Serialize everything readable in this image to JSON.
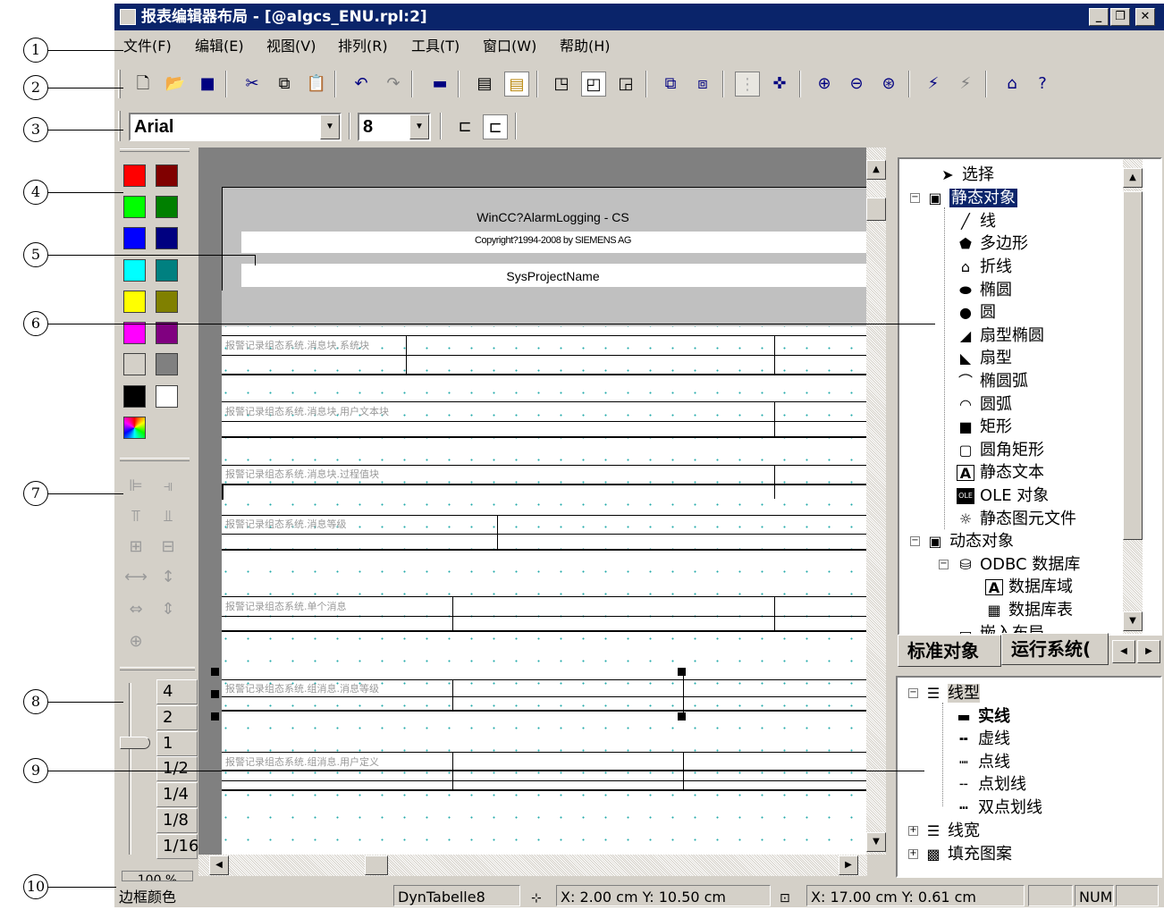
{
  "window": {
    "title": "报表编辑器布局 - [@algcs_ENU.rpl:2]",
    "buttons": [
      "_",
      "❐",
      "✕"
    ]
  },
  "callouts": [
    "1",
    "2",
    "3",
    "4",
    "5",
    "6",
    "7",
    "8",
    "9",
    "10"
  ],
  "menu": [
    "文件(F)",
    "编辑(E)",
    "视图(V)",
    "排列(R)",
    "工具(T)",
    "窗口(W)",
    "帮助(H)"
  ],
  "font_toolbar": {
    "font": "Arial",
    "size": "8"
  },
  "zoom": {
    "levels": [
      "4",
      "2",
      "1",
      "1/2",
      "1/4",
      "1/8",
      "1/16"
    ],
    "current": "1",
    "partial_label": "100 %"
  },
  "colors": {
    "palette": [
      "#ff0000",
      "#800000",
      "#00ff00",
      "#008000",
      "#0000ff",
      "#000080",
      "#00ffff",
      "#008080",
      "#ffff00",
      "#808000",
      "#ff00ff",
      "#800080",
      "#d4d0c8",
      "#808080",
      "#000000",
      "#ffffff"
    ],
    "titlebar": "#0a246a",
    "selection": "#0a246a"
  },
  "report": {
    "header_line1": "WinCC?AlarmLogging - CS",
    "header_line2": "Copyright?1994-2008 by SIEMENS AG",
    "project_name": "SysProjectName",
    "rows": [
      "报警记录组态系统.消息块.系统块",
      "报警记录组态系统.消息块.用户文本块",
      "报警记录组态系统.消息块.过程值块",
      "报警记录组态系统.消息等级",
      "报警记录组态系统.单个消息",
      "报警记录组态系统.组消息.消息等级",
      "报警记录组态系统.组消息.用户定义"
    ]
  },
  "objects_tree": {
    "select": "选择",
    "static": "静态对象",
    "static_items": [
      "线",
      "多边形",
      "折线",
      "椭圆",
      "圆",
      "扇型椭圆",
      "扇型",
      "椭圆弧",
      "圆弧",
      "矩形",
      "圆角矩形",
      "静态文本",
      "OLE 对象",
      "静态图元文件"
    ],
    "dynamic": "动态对象",
    "odbc": "ODBC 数据库",
    "odbc_items": [
      "数据库域",
      "数据库表"
    ],
    "partial": "嵌入布局"
  },
  "tabs": [
    "标准对象",
    "运行系统("
  ],
  "style_tree": {
    "line_type": "线型",
    "line_type_items": [
      "实线",
      "虚线",
      "点线",
      "点划线",
      "双点划线"
    ],
    "line_width": "线宽",
    "fill_pattern": "填充图案"
  },
  "status": {
    "message": "边框颜色",
    "object": "DynTabelle8",
    "position": "X: 2.00 cm Y: 10.50 cm",
    "size": "X: 17.00 cm Y: 0.61 cm",
    "num": "NUM"
  }
}
